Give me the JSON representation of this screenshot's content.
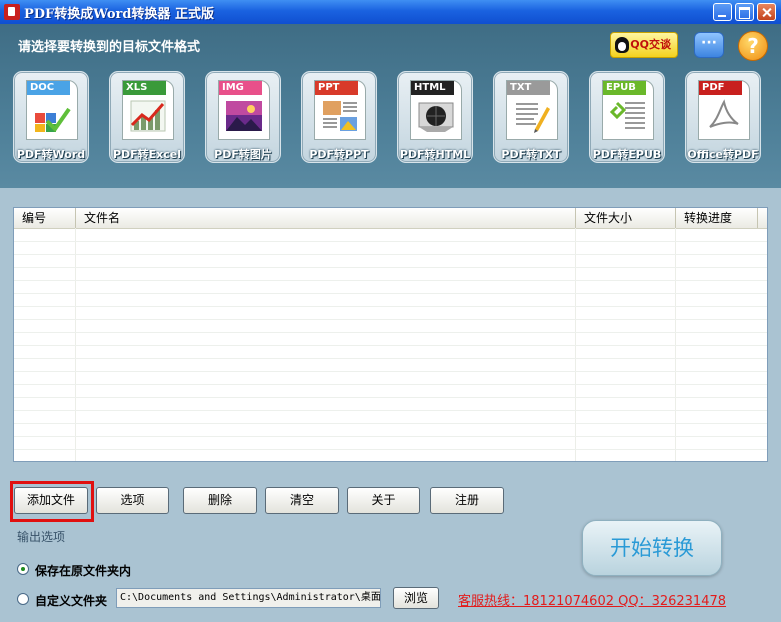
{
  "window": {
    "title": "PDF转换成Word转换器 正式版"
  },
  "header": {
    "prompt": "请选择要转换到的目标文件格式",
    "qq_chat_label": "QQ交谈",
    "message_glyph": "···",
    "help_glyph": "?"
  },
  "formats": [
    {
      "tag": "DOC",
      "label": "PDF转Word",
      "color": "#4aa3e6"
    },
    {
      "tag": "XLS",
      "label": "PDF转Excel",
      "color": "#3a9a3a"
    },
    {
      "tag": "IMG",
      "label": "PDF转图片",
      "color": "#e8508a"
    },
    {
      "tag": "PPT",
      "label": "PDF转PPT",
      "color": "#d83a2a"
    },
    {
      "tag": "HTML",
      "label": "PDF转HTML",
      "color": "#222222"
    },
    {
      "tag": "TXT",
      "label": "PDF转TXT",
      "color": "#9a9a9a"
    },
    {
      "tag": "EPUB",
      "label": "PDF转EPUB",
      "color": "#6ab82a"
    },
    {
      "tag": "PDF",
      "label": "Office转PDF",
      "color": "#c8201e"
    }
  ],
  "table": {
    "columns": [
      "编号",
      "文件名",
      "文件大小",
      "转换进度"
    ]
  },
  "actions": {
    "add_file": "添加文件",
    "options": "选项",
    "delete": "删除",
    "clear": "清空",
    "about": "关于",
    "register": "注册"
  },
  "output": {
    "title": "输出选项",
    "save_original": "保存在原文件夹内",
    "custom_folder": "自定义文件夹",
    "path_value": "C:\\Documents and Settings\\Administrator\\桌面",
    "browse": "浏览",
    "selected": "save_original"
  },
  "hotline": "客服热线：18121074602 QQ：326231478",
  "start": "开始转换"
}
